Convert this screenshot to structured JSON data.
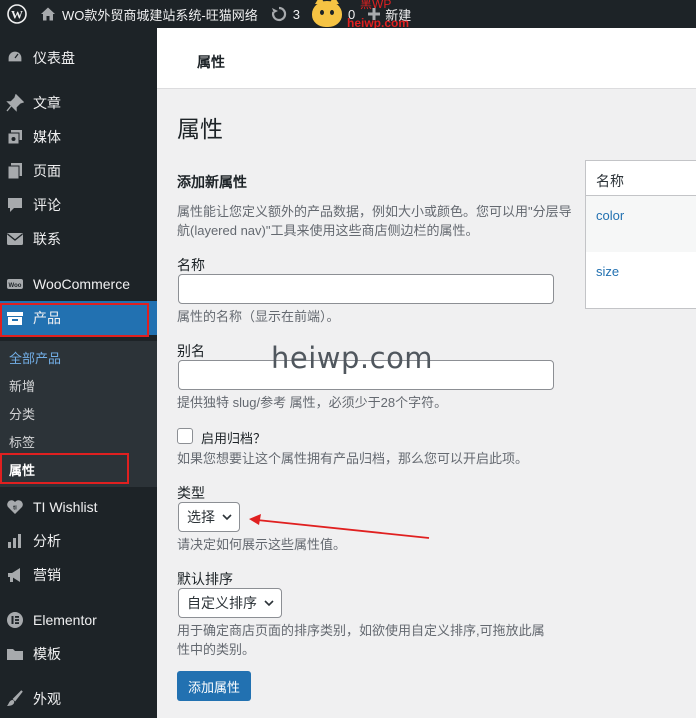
{
  "adminbar": {
    "site_name": "WO款外贸商城建站系统-旺猫网络",
    "updates_count": "3",
    "comments_count": "0",
    "new_label": "新建",
    "watermark_top": "黑WP",
    "watermark_bottom": "heiwp.com"
  },
  "sidebar": {
    "items": [
      {
        "label": "仪表盘",
        "icon": "dashboard-icon"
      },
      {
        "label": "文章",
        "icon": "pin-icon"
      },
      {
        "label": "媒体",
        "icon": "media-icon"
      },
      {
        "label": "页面",
        "icon": "page-icon"
      },
      {
        "label": "评论",
        "icon": "comment-icon"
      },
      {
        "label": "联系",
        "icon": "mail-icon"
      },
      {
        "label": "WooCommerce",
        "icon": "woo-icon"
      },
      {
        "label": "产品",
        "icon": "archive-icon"
      },
      {
        "label": "TI Wishlist",
        "icon": "heart-icon"
      },
      {
        "label": "分析",
        "icon": "chart-icon"
      },
      {
        "label": "营销",
        "icon": "megaphone-icon"
      },
      {
        "label": "Elementor",
        "icon": "elementor-icon"
      },
      {
        "label": "模板",
        "icon": "folder-icon"
      },
      {
        "label": "外观",
        "icon": "brush-icon"
      }
    ],
    "submenu": [
      "全部产品",
      "新增",
      "分类",
      "标签",
      "属性"
    ]
  },
  "topbar": {
    "title": "属性"
  },
  "main": {
    "page_title": "属性",
    "form_heading": "添加新属性",
    "intro_line1": "属性能让您定义额外的产品数据，例如大小或颜色。您可以用\"分层导",
    "intro_line2": "航(layered nav)\"工具来使用这些商店侧边栏的属性。",
    "name_label": "名称",
    "name_value": "",
    "name_help": "属性的名称（显示在前端）。",
    "slug_label": "别名",
    "slug_value": "",
    "slug_help": "提供独特 slug/参考 属性，必须少于28个字符。",
    "archive_label": "启用归档？",
    "archive_help": "如果您想要让这个属性拥有产品归档，那么您可以开启此项。",
    "type_label": "类型",
    "type_value": "选择",
    "type_help": "请决定如何展示这些属性值。",
    "order_label": "默认排序",
    "order_value": "自定义排序",
    "order_help_line1": "用于确定商店页面的排序类别，如欲使用自定义排序,可拖放此属",
    "order_help_line2": "性中的类别。",
    "submit_label": "添加属性"
  },
  "watermark": "heiwp.com",
  "table": {
    "header": "名称",
    "rows": [
      "color",
      "size"
    ]
  },
  "colors": {
    "accent": "#2271b1",
    "sidebar_bg": "#1d2327",
    "highlight_red": "#e02020"
  }
}
